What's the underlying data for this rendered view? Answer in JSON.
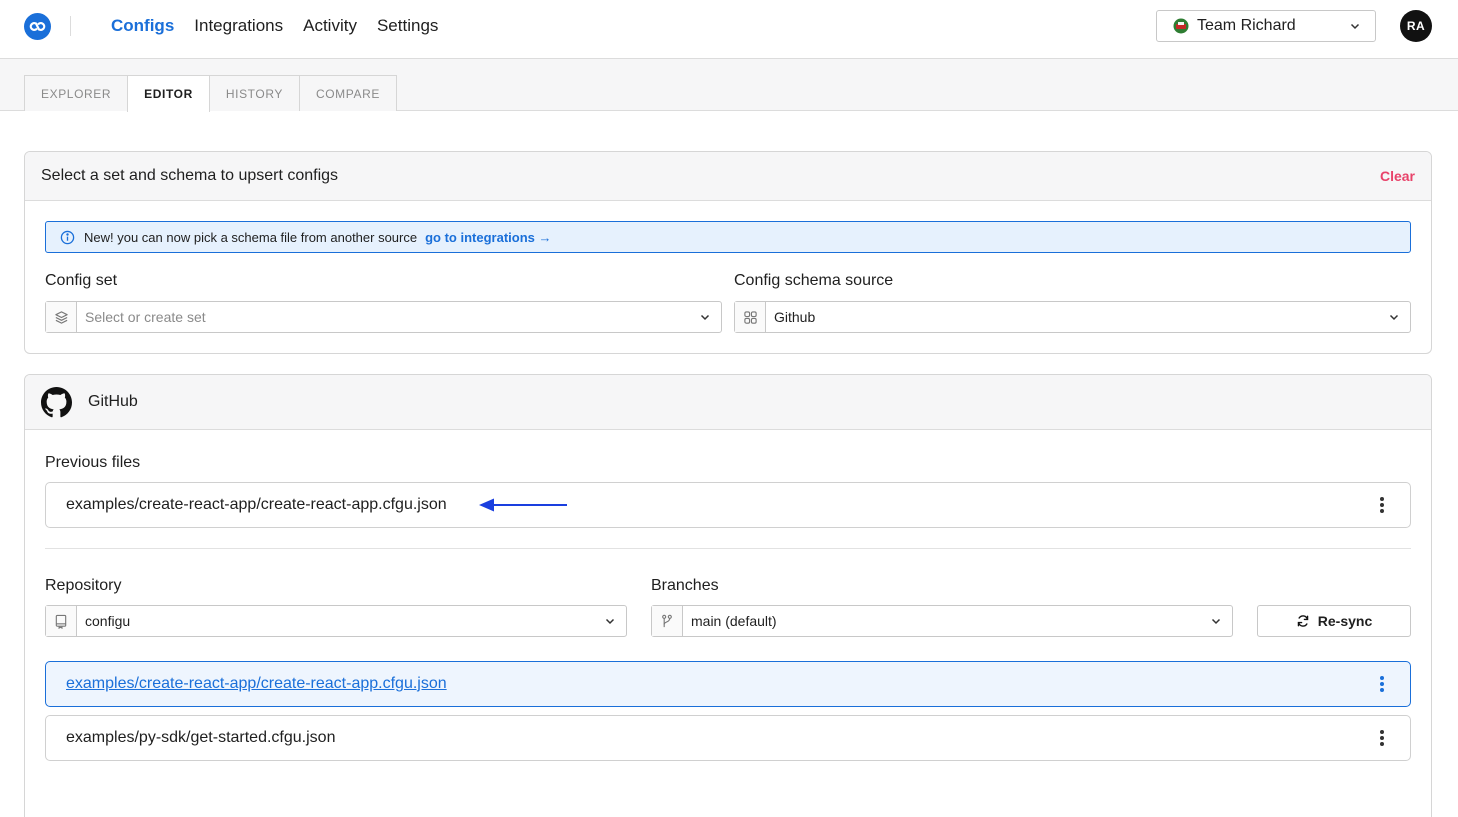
{
  "nav": {
    "items": [
      {
        "label": "Configs",
        "active": true
      },
      {
        "label": "Integrations",
        "active": false
      },
      {
        "label": "Activity",
        "active": false
      },
      {
        "label": "Settings",
        "active": false
      }
    ],
    "team_label": "Team Richard",
    "avatar_initials": "RA"
  },
  "tabs": [
    {
      "label": "EXPLORER",
      "active": false
    },
    {
      "label": "EDITOR",
      "active": true
    },
    {
      "label": "HISTORY",
      "active": false
    },
    {
      "label": "COMPARE",
      "active": false
    }
  ],
  "select_card": {
    "title": "Select a set and schema to upsert configs",
    "clear_label": "Clear",
    "banner": {
      "text": "New! you can now pick a schema file from another source",
      "link": "go to integrations →"
    },
    "config_set": {
      "label": "Config set",
      "placeholder": "Select or create set"
    },
    "schema_source": {
      "label": "Config schema source",
      "value": "Github"
    }
  },
  "github_card": {
    "title": "GitHub",
    "previous_files_label": "Previous files",
    "previous_files": [
      "examples/create-react-app/create-react-app.cfgu.json"
    ],
    "repository": {
      "label": "Repository",
      "value": "configu"
    },
    "branches": {
      "label": "Branches",
      "value": "main (default)"
    },
    "resync_label": "Re-sync",
    "files": [
      {
        "name": "examples/create-react-app/create-react-app.cfgu.json",
        "selected": true
      },
      {
        "name": "examples/py-sdk/get-started.cfgu.json",
        "selected": false
      }
    ]
  },
  "colors": {
    "accent": "#1a6fd9",
    "danger": "#e8436a",
    "arrow": "#1a3fdf"
  }
}
